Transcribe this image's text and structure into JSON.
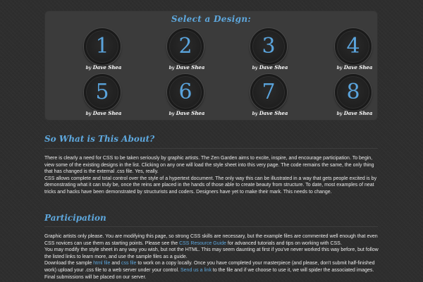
{
  "design_panel": {
    "title": "Select a Design:",
    "designs": [
      {
        "number": "1",
        "by": "by",
        "author": "Dave Shea"
      },
      {
        "number": "2",
        "by": "by",
        "author": "Dave Shea"
      },
      {
        "number": "3",
        "by": "by",
        "author": "Dave Shea"
      },
      {
        "number": "4",
        "by": "by",
        "author": "Dave Shea"
      },
      {
        "number": "5",
        "by": "by",
        "author": "Dave Shea"
      },
      {
        "number": "6",
        "by": "by",
        "author": "Dave Shea"
      },
      {
        "number": "7",
        "by": "by",
        "author": "Dave Shea"
      },
      {
        "number": "8",
        "by": "by",
        "author": "Dave Shea"
      }
    ]
  },
  "about": {
    "heading": "So What is This About?",
    "p1": "There is clearly a need for CSS to be taken seriously by graphic artists. The Zen Garden aims to excite, inspire, and encourage participation. To begin, view some of the existing designs in the list. Clicking on any one will load the style sheet into this very page. The code remains the same, the only thing that has changed is the external .css file. Yes, really.",
    "p2": "CSS allows complete and total control over the style of a hypertext document. The only way this can be illustrated in a way that gets people excited is by demonstrating what it can truly be, once the reins are placed in the hands of those able to create beauty from structure. To date, most examples of neat tricks and hacks have been demonstrated by structurists and coders. Designers have yet to make their mark. This needs to change."
  },
  "participation": {
    "heading": "Participation",
    "p1_before": "Graphic artists only please. You are modifying this page, so strong CSS skills are necessary, but the example files are commented well enough that even CSS novices can use them as starting points. Please see the ",
    "p1_link": "CSS Resource Guide",
    "p1_after": " for advanced tutorials and tips on working with CSS.",
    "p2": "You may modify the style sheet in any way you wish, but not the HTML. This may seem daunting at first if you've never worked this way before, but follow the listed links to learn more, and use the sample files as a guide.",
    "p3_before": "Download the sample ",
    "p3_link1": "html file",
    "p3_mid": " and ",
    "p3_link2": "css file",
    "p3_after": " to work on a copy locally. Once you have completed your masterpiece (and please, don't submit half-finished work) upload your .css file to a web server under your control. ",
    "p3_link3": "Send us a link",
    "p3_end": " to the file and if we choose to use it, we will spider the associated images. Final submissions will be placed on our server."
  }
}
